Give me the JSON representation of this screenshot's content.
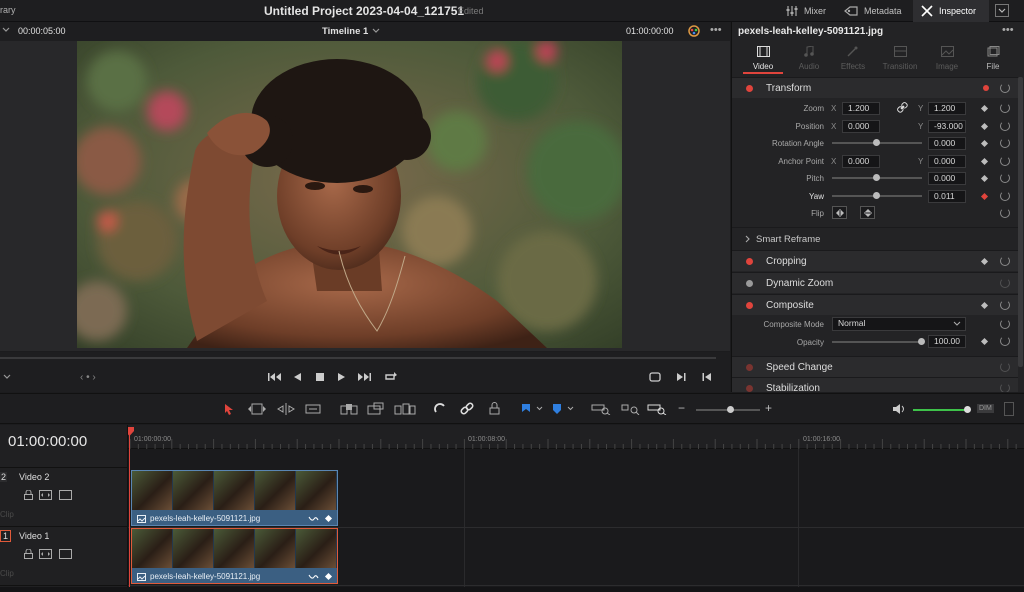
{
  "topbar": {
    "library_label": "rary",
    "project_title": "Untitled Project 2023-04-04_121751",
    "edited_label": "Edited",
    "mixer_label": "Mixer",
    "metadata_label": "Metadata",
    "inspector_label": "Inspector"
  },
  "viewer": {
    "source_timecode": "00:00:05:00",
    "timeline_name": "Timeline 1",
    "record_timecode": "01:00:00:00"
  },
  "inspector": {
    "clip_name": "pexels-leah-kelley-5091121.jpg",
    "tabs": [
      {
        "label": "Video",
        "active": true
      },
      {
        "label": "Audio",
        "active": false
      },
      {
        "label": "Effects",
        "active": false
      },
      {
        "label": "Transition",
        "active": false
      },
      {
        "label": "Image",
        "active": false
      },
      {
        "label": "File",
        "active": false
      }
    ],
    "transform": {
      "title": "Transform",
      "zoom_label": "Zoom",
      "zoom_x": "1.200",
      "zoom_y": "1.200",
      "position_label": "Position",
      "position_x": "0.000",
      "position_y": "-93.000",
      "rotation_label": "Rotation Angle",
      "rotation_value": "0.000",
      "anchor_label": "Anchor Point",
      "anchor_x": "0.000",
      "anchor_y": "0.000",
      "pitch_label": "Pitch",
      "pitch_value": "0.000",
      "yaw_label": "Yaw",
      "yaw_value": "0.011",
      "flip_label": "Flip",
      "x_axis": "X",
      "y_axis": "Y"
    },
    "smart_reframe": "Smart Reframe",
    "cropping": "Cropping",
    "dynamic_zoom": "Dynamic Zoom",
    "composite": {
      "title": "Composite",
      "mode_label": "Composite Mode",
      "mode_value": "Normal",
      "opacity_label": "Opacity",
      "opacity_value": "100.00"
    },
    "speed_change": "Speed Change",
    "stabilization": "Stabilization"
  },
  "timeline": {
    "current_timecode": "01:00:00:00",
    "ruler": [
      "01:00:00:00",
      "01:00:08:00",
      "01:00:16:00"
    ],
    "tracks": [
      {
        "index": "2",
        "name": "Video 2",
        "clip_label": "Clip",
        "clip_name": "pexels-leah-kelley-5091121.jpg"
      },
      {
        "index": "1",
        "name": "Video 1",
        "clip_label": "Clip",
        "clip_name": "pexels-leah-kelley-5091121.jpg"
      }
    ],
    "dim_label": "DIM"
  },
  "colors": {
    "accent_red": "#e0443c",
    "clip_blue": "#3b5f82",
    "selected_border": "#e05a3a",
    "audio_green": "#3ec24a",
    "marker_blue": "#2f7fe0"
  }
}
